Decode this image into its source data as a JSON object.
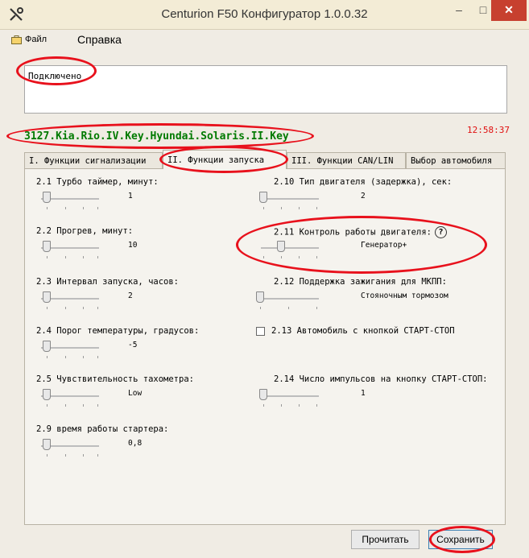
{
  "window": {
    "title": "Centurion F50 Конфигуратор 1.0.0.32",
    "minimize": "–",
    "maximize": "□",
    "close": "✕"
  },
  "menu": {
    "file": "Файл",
    "help": "Справка"
  },
  "status": {
    "text": "Подключено"
  },
  "car_name": "3127.Kia.Rio.IV.Key.Hyundai.Solaris.II.Key",
  "clock": "12:58:37",
  "tabs": [
    {
      "label": "I. Функции сигнализации",
      "active": false
    },
    {
      "label": "II. Функции запуска",
      "active": true
    },
    {
      "label": "III. Функции CAN/LIN",
      "active": false
    },
    {
      "label": "Выбор автомобиля",
      "active": false
    }
  ],
  "params": {
    "p2_1": {
      "label": "2.1 Турбо таймер, минут:",
      "value": "1"
    },
    "p2_2": {
      "label": "2.2 Прогрев, минут:",
      "value": "10"
    },
    "p2_3": {
      "label": "2.3 Интервал запуска, часов:",
      "value": "2"
    },
    "p2_4": {
      "label": "2.4 Порог температуры, градусов:",
      "value": "-5"
    },
    "p2_5": {
      "label": "2.5 Чувствительность тахометра:",
      "value": "Low"
    },
    "p2_9": {
      "label": "2.9 время работы стартера:",
      "value": "0,8"
    },
    "p2_10": {
      "label": "2.10 Тип двигателя (задержка), сек:",
      "value": "2"
    },
    "p2_11": {
      "label": "2.11 Контроль работы двигателя:",
      "value": "Генератор+",
      "help": "?"
    },
    "p2_12": {
      "label": "2.12 Поддержка зажигания для МКПП:",
      "value": "Стояночным тормозом"
    },
    "p2_13": {
      "label": "2.13 Автомобиль с кнопкой СТАРТ-СТОП",
      "checked": false
    },
    "p2_14": {
      "label": "2.14 Число импульсов на кнопку СТАРТ-СТОП:",
      "value": "1"
    }
  },
  "buttons": {
    "read": "Прочитать",
    "save": "Сохранить"
  },
  "colors": {
    "car_name": "#007a00",
    "clock": "#e01010",
    "annotation": "#e8111c"
  }
}
